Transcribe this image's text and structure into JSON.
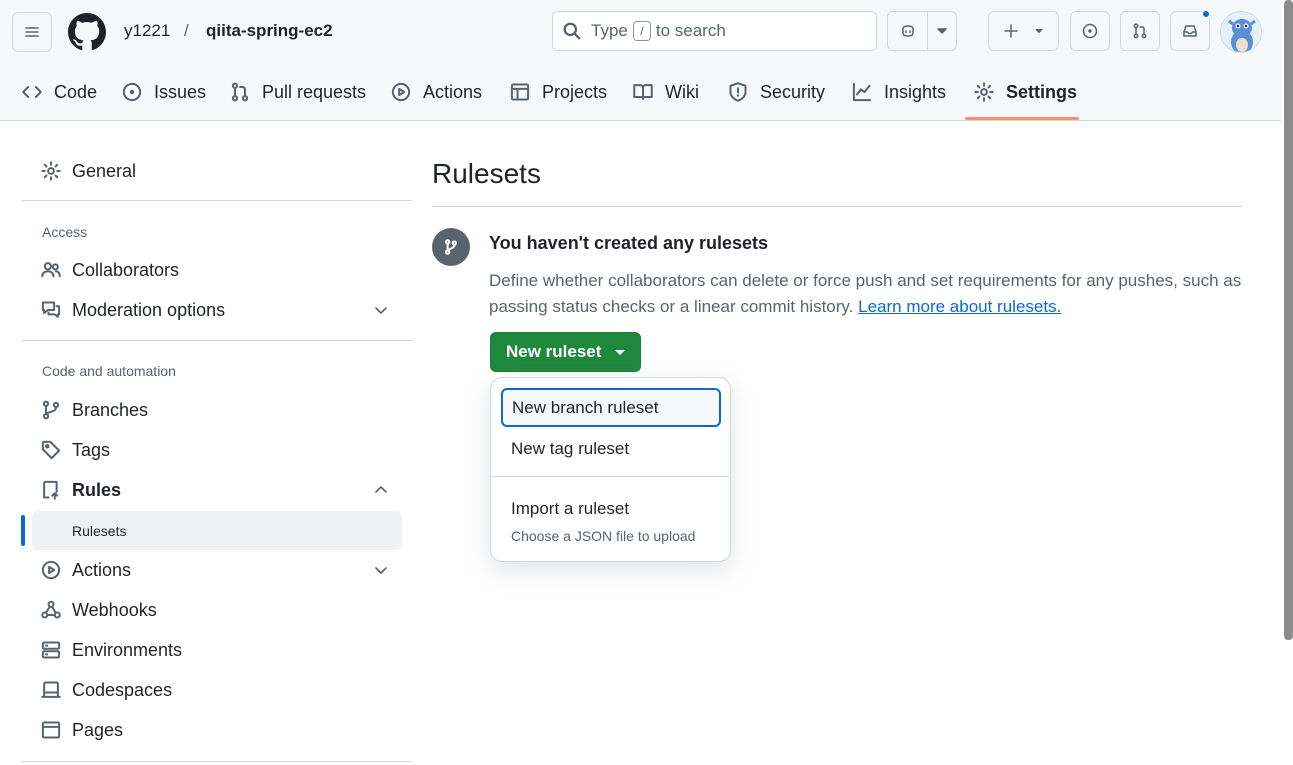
{
  "header": {
    "owner": "y1221",
    "separator": "/",
    "repo": "qiita-spring-ec2",
    "search": {
      "prefix": "Type",
      "key": "/",
      "suffix": "to search"
    }
  },
  "tabs": [
    {
      "label": "Code",
      "icon": "code-icon"
    },
    {
      "label": "Issues",
      "icon": "issue-icon"
    },
    {
      "label": "Pull requests",
      "icon": "pull-request-icon"
    },
    {
      "label": "Actions",
      "icon": "play-icon"
    },
    {
      "label": "Projects",
      "icon": "table-icon"
    },
    {
      "label": "Wiki",
      "icon": "book-icon"
    },
    {
      "label": "Security",
      "icon": "shield-icon"
    },
    {
      "label": "Insights",
      "icon": "graph-icon"
    },
    {
      "label": "Settings",
      "icon": "gear-icon",
      "active": true
    }
  ],
  "sidebar": {
    "general": "General",
    "access_heading": "Access",
    "collaborators": "Collaborators",
    "moderation": "Moderation options",
    "code_heading": "Code and automation",
    "branches": "Branches",
    "tags": "Tags",
    "rules": "Rules",
    "rulesets": "Rulesets",
    "actions": "Actions",
    "webhooks": "Webhooks",
    "environments": "Environments",
    "codespaces": "Codespaces",
    "pages": "Pages"
  },
  "main": {
    "title": "Rulesets",
    "blank_heading": "You haven't created any rulesets",
    "blank_desc": "Define whether collaborators can delete or force push and set requirements for any pushes, such as passing status checks or a linear commit history.",
    "learn_more": "Learn more about rulesets.",
    "new_button": "New ruleset"
  },
  "menu": {
    "branch": "New branch ruleset",
    "tag": "New tag ruleset",
    "import": "Import a ruleset",
    "import_desc": "Choose a JSON file to upload"
  },
  "colors": {
    "accent": "#0969da",
    "primary_button": "#1f883d",
    "active_tab_underline": "#fd8c73"
  }
}
